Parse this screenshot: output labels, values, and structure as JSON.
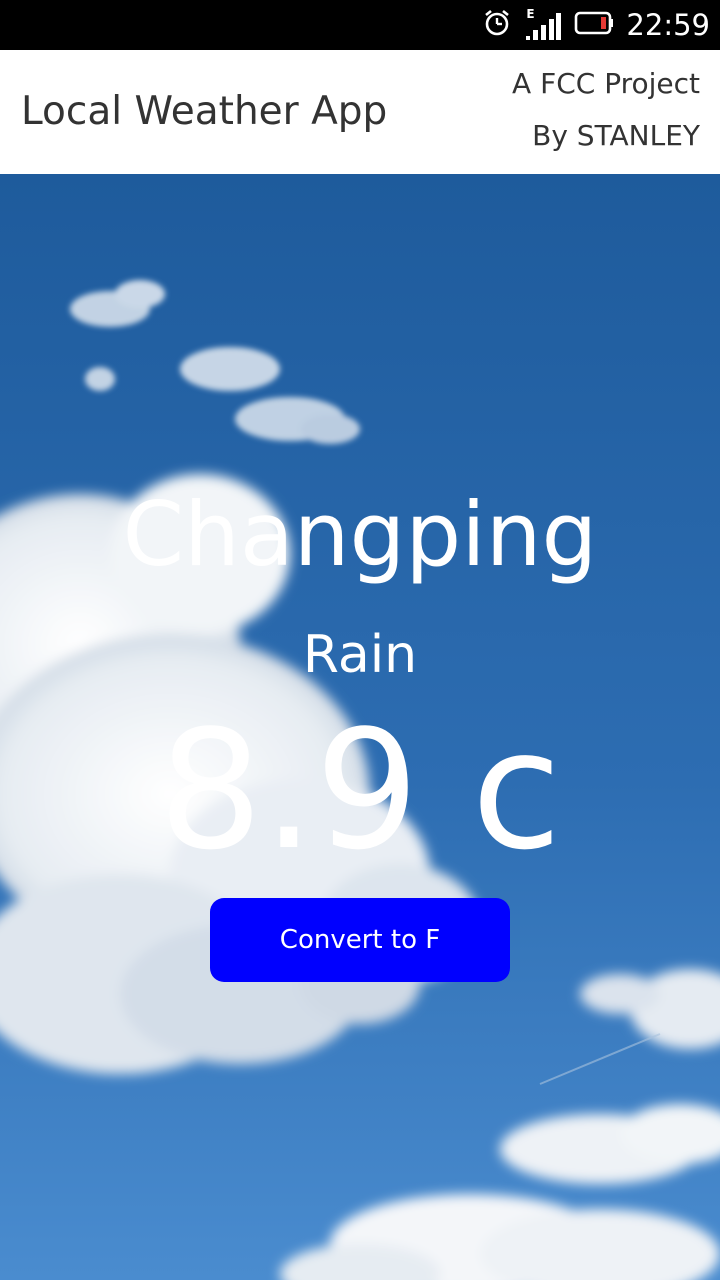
{
  "status_bar": {
    "time": "22:59",
    "network_type": "E",
    "icons": [
      "alarm-icon",
      "signal-icon",
      "battery-icon"
    ],
    "battery_color": "#e53935"
  },
  "header": {
    "title": "Local Weather App",
    "project": "A FCC Project",
    "author": "By STANLEY"
  },
  "weather": {
    "city": "Changping",
    "condition": "Rain",
    "temperature": "8.9 c"
  },
  "convert_button": {
    "label": "Convert to F",
    "color": "#0000ff"
  },
  "background": {
    "sky_top": "#1e5b9c",
    "sky_bottom": "#4a8ccf"
  }
}
